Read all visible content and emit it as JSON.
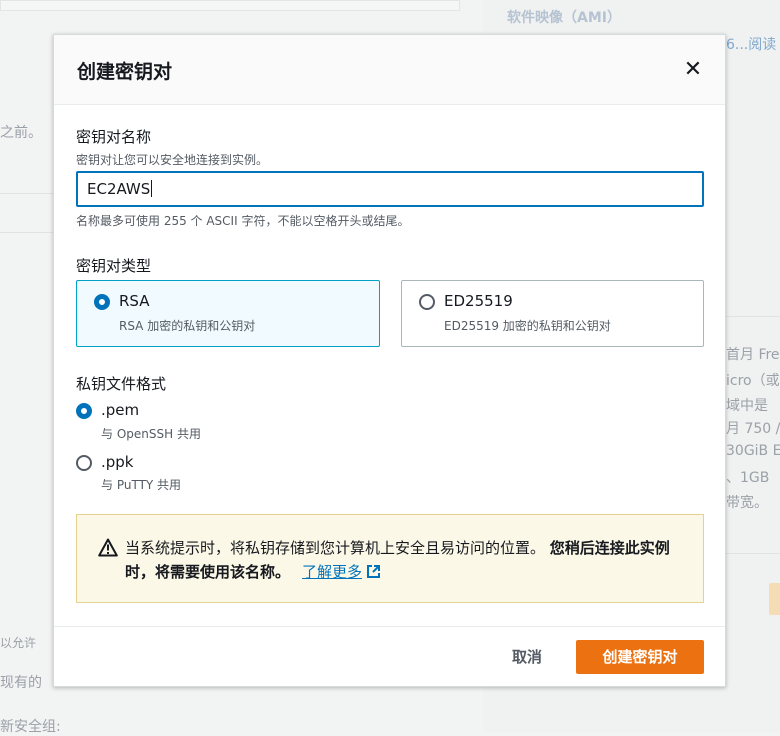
{
  "background": {
    "right_heading": "软件映像（AMI）",
    "right_link": "6...阅读",
    "left_fragment_1": "之前。",
    "left_fragment_2": "以允许",
    "left_fragment_3": "现有的",
    "left_fragment_4": "新安全组:",
    "free_tier_lines": [
      "首月 Free",
      "icro（或",
      "域中是",
      "月 750 /",
      "30GiB E",
      "、1GB",
      "带宽。"
    ]
  },
  "modal": {
    "title": "创建密钥对",
    "close_label": "✕",
    "key_name": {
      "label": "密钥对名称",
      "description": "密钥对让您可以安全地连接到实例。",
      "value": "EC2AWS",
      "constraint": "名称最多可使用 255 个 ASCII 字符，不能以空格开头或结尾。"
    },
    "key_type": {
      "label": "密钥对类型",
      "options": [
        {
          "title": "RSA",
          "description": "RSA 加密的私钥和公钥对",
          "selected": true
        },
        {
          "title": "ED25519",
          "description": "ED25519 加密的私钥和公钥对",
          "selected": false
        }
      ]
    },
    "file_format": {
      "label": "私钥文件格式",
      "options": [
        {
          "title": ".pem",
          "description": "与 OpenSSH 共用",
          "selected": true
        },
        {
          "title": ".ppk",
          "description": "与 PuTTY 共用",
          "selected": false
        }
      ]
    },
    "alert": {
      "icon": "warning-icon",
      "text_plain": "当系统提示时，将私钥存储到您计算机上安全且易访问的位置。",
      "text_bold": "您稍后连接此实例时，将需要使用该名称。",
      "link": "了解更多"
    },
    "footer": {
      "cancel": "取消",
      "create": "创建密钥对"
    }
  },
  "colors": {
    "primary": "#ec7211",
    "link": "#0073bb",
    "selected_tile_bg": "#f1faff",
    "alert_bg": "#fcf8e7"
  }
}
